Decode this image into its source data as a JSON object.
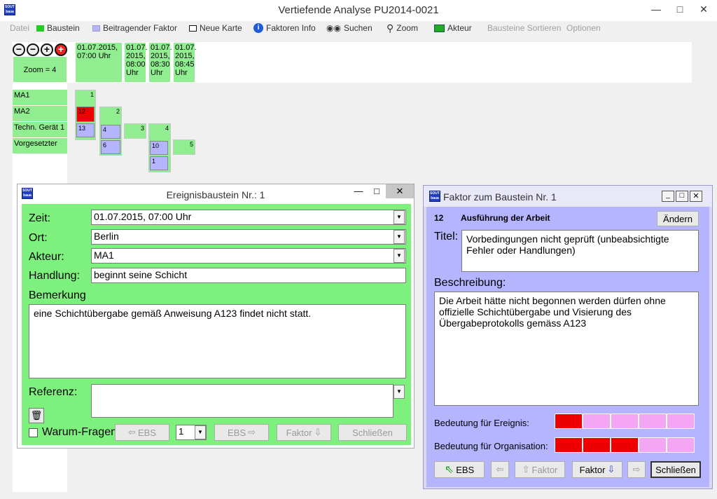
{
  "window": {
    "title": "Vertiefende Analyse PU2014-0021",
    "logo": "SOUT baua"
  },
  "menu": [
    {
      "label": "Datei",
      "icon": "",
      "disabled": true
    },
    {
      "label": "Baustein",
      "icon": "green-square",
      "disabled": false
    },
    {
      "label": "Beitragender Faktor",
      "icon": "lavender-square",
      "disabled": false
    },
    {
      "label": "Neue Karte",
      "icon": "white-square",
      "disabled": false
    },
    {
      "label": "Faktoren Info",
      "icon": "info-icon",
      "disabled": false
    },
    {
      "label": "Suchen",
      "icon": "binoculars-icon",
      "disabled": false
    },
    {
      "label": "Zoom",
      "icon": "magnifier-icon",
      "disabled": false
    },
    {
      "label": "Akteur",
      "icon": "actor-icon",
      "disabled": false
    },
    {
      "label": "Bausteine Sortieren",
      "icon": "",
      "disabled": true
    },
    {
      "label": "Optionen",
      "icon": "",
      "disabled": true
    }
  ],
  "zoom": {
    "label": "Zoom = 4",
    "buttons": [
      "−",
      "−",
      "+",
      "+"
    ]
  },
  "timeline": [
    "01.07.2015, 07:00 Uhr",
    "01.07. 2015, 08:00 Uhr",
    "01.07. 2015, 08:30 Uhr",
    "01.07. 2015, 08:45 Uhr"
  ],
  "rows": [
    "MA1",
    "MA2",
    "Techn. Gerät 1",
    "Vorgesetzter"
  ],
  "blocks": [
    {
      "num": "1"
    },
    {
      "num": "2"
    },
    {
      "num": "3"
    },
    {
      "num": "4"
    },
    {
      "num": "5"
    }
  ],
  "factors": [
    "12",
    "13",
    "4",
    "6",
    "10",
    "1"
  ],
  "event_window": {
    "title": "Ereignisbaustein Nr.: 1",
    "zeit_label": "Zeit:",
    "zeit": "01.07.2015, 07:00 Uhr",
    "ort_label": "Ort:",
    "ort": "Berlin",
    "akteur_label": "Akteur:",
    "akteur": "MA1",
    "handlung_label": "Handlung:",
    "handlung": "beginnt seine Schicht",
    "bemerkung_label": "Bemerkung",
    "bemerkung": "eine Schichtübergabe gemäß Anweisung A123 findet nicht statt.",
    "referenz_label": "Referenz:",
    "referenz": "",
    "warum_label": "Warum-Fragen",
    "ebs_back": "EBS",
    "page": "1",
    "ebs_fwd": "EBS",
    "faktor": "Faktor",
    "close": "Schließen"
  },
  "factor_window": {
    "title": "Faktor zum Baustein Nr. 1",
    "code": "12",
    "name": "Ausführung der Arbeit",
    "change": "Ändern",
    "titel_label": "Titel:",
    "titel": "Vorbedingungen nicht geprüft (unbeabsichtigte Fehler oder Handlungen)",
    "beschreibung_label": "Beschreibung:",
    "beschreibung": "Die Arbeit hätte nicht begonnen werden dürfen ohne offizielle Schichtübergabe und Visierung des Übergabeprotokolls gemäss A123",
    "bedeutung_ereignis_label": "Bedeutung für Ereignis:",
    "bedeutung_ereignis": 1,
    "bedeutung_org_label": "Bedeutung für Organisation:",
    "bedeutung_org": 3,
    "scale_max": 5,
    "ebs": "EBS",
    "faktor_back": "Faktor",
    "faktor_fwd": "Faktor",
    "close": "Schließen"
  },
  "colors": {
    "green": "#90ee90",
    "lavender": "#b4b4ff",
    "red": "#ee0000",
    "pink": "#f4a6f4"
  }
}
